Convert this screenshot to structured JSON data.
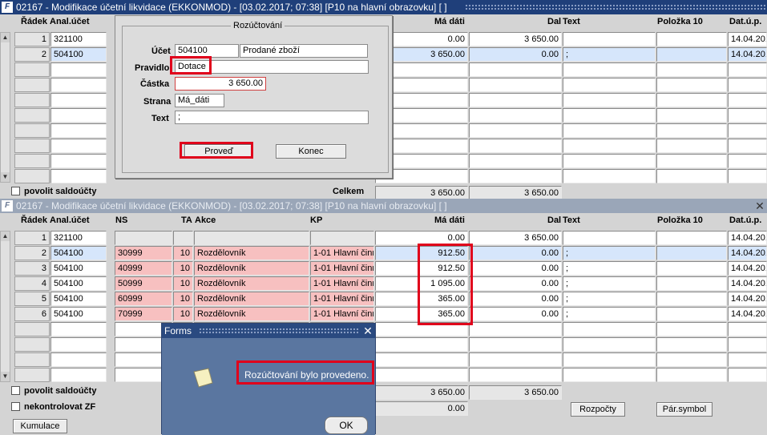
{
  "window1": {
    "title": "02167 - Modifikace účetní likvidace (EKKONMOD) - [03.02.2017; 07:38]",
    "title_extra": "[P10 na hlavní obrazovku]  [ ]",
    "headers": {
      "radek": "Řádek",
      "anal": "Anal.účet",
      "ma_dati": "Má dáti",
      "dal": "Dal",
      "text": "Text",
      "polozka": "Položka 10",
      "dat": "Dat.ú.p."
    },
    "rows": [
      {
        "n": "1",
        "acct": "321100",
        "ma": "0.00",
        "dal": "3 650.00",
        "text": "",
        "dat": "14.04.201"
      },
      {
        "n": "2",
        "acct": "504100",
        "ma": "3 650.00",
        "dal": "0.00",
        "text": ";",
        "dat": "14.04.201"
      }
    ],
    "checkbox_label": "povolit saldoúčty",
    "celkem_label": "Celkem",
    "celkem_ma": "3 650.00",
    "celkem_dal": "3 650.00"
  },
  "dialog": {
    "group_title": "Rozúčtování",
    "ucet_label": "Účet",
    "ucet_value": "504100",
    "ucet_name": "Prodané zboží",
    "pravidlo_label": "Pravidlo",
    "pravidlo_value": "Dotace",
    "castka_label": "Částka",
    "castka_value": "3 650.00",
    "strana_label": "Strana",
    "strana_value": "Má_dáti",
    "text_label": "Text",
    "text_value": ";",
    "proved_label": "Proveď",
    "konec_label": "Konec"
  },
  "window2": {
    "title": "02167 - Modifikace účetní likvidace (EKKONMOD) - [03.02.2017; 07:38]",
    "title_extra": "[P10 na hlavní obrazovku]  [ ]",
    "headers": {
      "radek": "Řádek",
      "anal": "Anal.účet",
      "ns": "NS",
      "ta": "TA",
      "akce": "Akce",
      "kp": "KP",
      "ma_dati": "Má dáti",
      "dal": "Dal",
      "text": "Text",
      "polozka": "Položka 10",
      "dat": "Dat.ú.p."
    },
    "rows": [
      {
        "n": "1",
        "acct": "321100",
        "ns": "",
        "ta": "",
        "akce": "",
        "kp": "",
        "ma": "0.00",
        "dal": "3 650.00",
        "text": "",
        "dat": "14.04.201"
      },
      {
        "n": "2",
        "acct": "504100",
        "ns": "30999",
        "ta": "10",
        "akce": "Rozdělovník",
        "kp": "1-01 Hlavní činn",
        "ma": "912.50",
        "dal": "0.00",
        "text": ";",
        "dat": "14.04.201"
      },
      {
        "n": "3",
        "acct": "504100",
        "ns": "40999",
        "ta": "10",
        "akce": "Rozdělovník",
        "kp": "1-01 Hlavní činn",
        "ma": "912.50",
        "dal": "0.00",
        "text": ";",
        "dat": "14.04.201"
      },
      {
        "n": "4",
        "acct": "504100",
        "ns": "50999",
        "ta": "10",
        "akce": "Rozdělovník",
        "kp": "1-01 Hlavní činn",
        "ma": "1 095.00",
        "dal": "0.00",
        "text": ";",
        "dat": "14.04.201"
      },
      {
        "n": "5",
        "acct": "504100",
        "ns": "60999",
        "ta": "10",
        "akce": "Rozdělovník",
        "kp": "1-01 Hlavní činn",
        "ma": "365.00",
        "dal": "0.00",
        "text": ";",
        "dat": "14.04.201"
      },
      {
        "n": "6",
        "acct": "504100",
        "ns": "70999",
        "ta": "10",
        "akce": "Rozdělovník",
        "kp": "1-01 Hlavní činn",
        "ma": "365.00",
        "dal": "0.00",
        "text": ";",
        "dat": "14.04.201"
      }
    ],
    "chk1_label": "povolit saldoúčty",
    "chk2_label": "nekontrolovat ZF",
    "total_ma": "3 650.00",
    "total_dal": "3 650.00",
    "diff": "0.00",
    "kumulace_label": "Kumulace",
    "rozpocty_label": "Rozpočty",
    "parsymbol_label": "Pár.symbol"
  },
  "forms_dialog": {
    "title": "Forms",
    "message": "Rozúčtování bylo provedeno.",
    "ok_label": "OK"
  }
}
